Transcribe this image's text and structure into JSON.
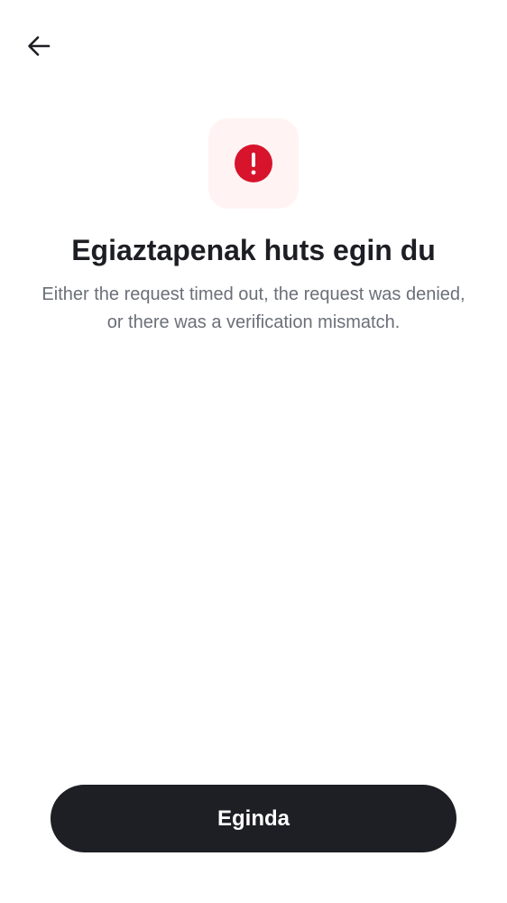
{
  "header": {
    "back_icon": "arrow-left-icon"
  },
  "status": {
    "icon": "exclamation-circle-icon",
    "icon_color": "#d7142b",
    "tile_color": "#fff4f3"
  },
  "content": {
    "title": "Egiaztapenak huts egin du",
    "description": "Either the request timed out, the request was denied, or there was a verification mismatch."
  },
  "footer": {
    "done_label": "Eginda",
    "button_color": "#1e1f24"
  }
}
